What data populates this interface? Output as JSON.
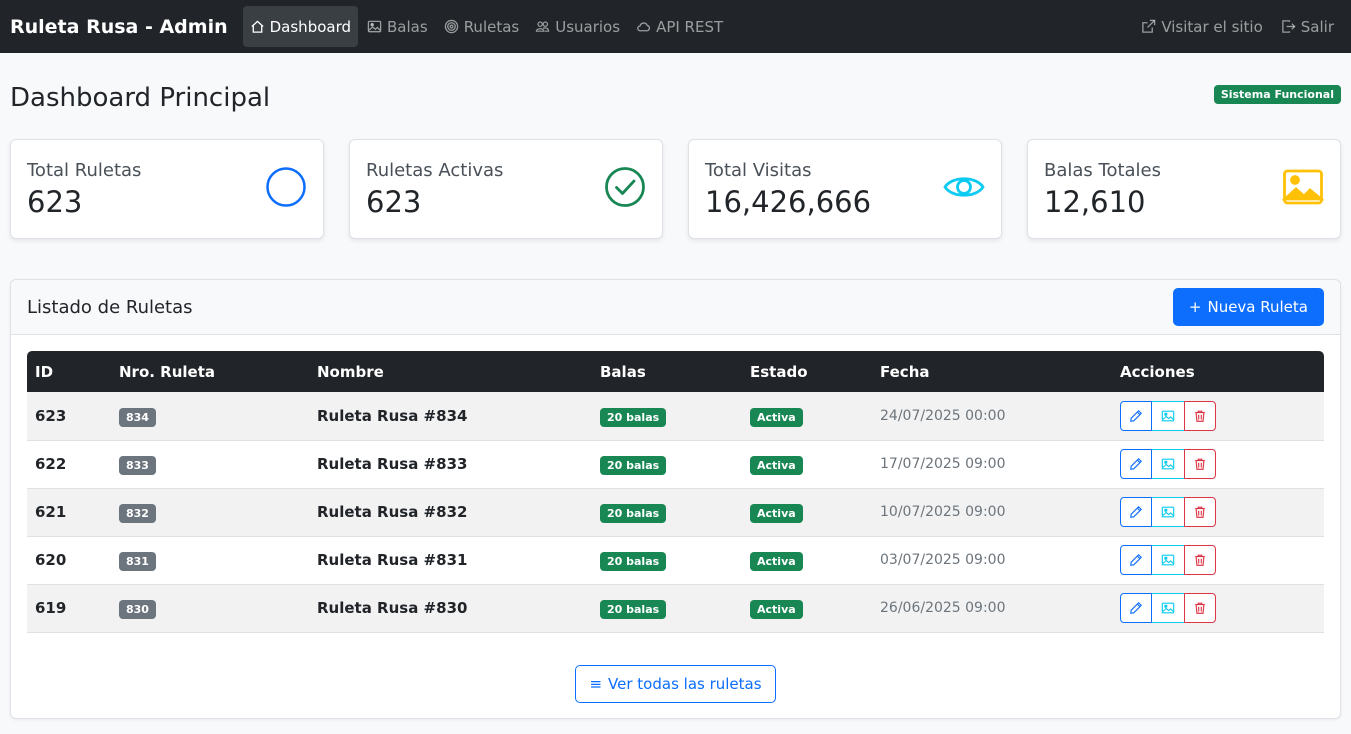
{
  "navbar": {
    "brand": "Ruleta Rusa - Admin",
    "items": [
      {
        "label": "Dashboard",
        "icon": "house-icon",
        "active": true
      },
      {
        "label": "Balas",
        "icon": "image-icon",
        "active": false
      },
      {
        "label": "Ruletas",
        "icon": "target-icon",
        "active": false
      },
      {
        "label": "Usuarios",
        "icon": "people-icon",
        "active": false
      },
      {
        "label": "API REST",
        "icon": "cloud-icon",
        "active": false
      }
    ],
    "right": [
      {
        "label": "Visitar el sitio",
        "icon": "external-link-icon"
      },
      {
        "label": "Salir",
        "icon": "logout-icon"
      }
    ]
  },
  "page": {
    "title": "Dashboard Principal",
    "status": "Sistema Funcional"
  },
  "stats": [
    {
      "label": "Total Ruletas",
      "value": "623",
      "icon": "circle-icon",
      "color": "#0d6efd"
    },
    {
      "label": "Ruletas Activas",
      "value": "623",
      "icon": "check-circle-icon",
      "color": "#198754"
    },
    {
      "label": "Total Visitas",
      "value": "16,426,666",
      "icon": "eye-icon",
      "color": "#0dcaf0"
    },
    {
      "label": "Balas Totales",
      "value": "12,610",
      "icon": "image-icon",
      "color": "#ffc107"
    }
  ],
  "list": {
    "title": "Listado de Ruletas",
    "new_button": "Nueva Ruleta",
    "columns": [
      "ID",
      "Nro. Ruleta",
      "Nombre",
      "Balas",
      "Estado",
      "Fecha",
      "Acciones"
    ],
    "rows": [
      {
        "id": "623",
        "nro": "834",
        "nombre": "Ruleta Rusa #834",
        "balas": "20 balas",
        "estado": "Activa",
        "fecha": "24/07/2025 00:00"
      },
      {
        "id": "622",
        "nro": "833",
        "nombre": "Ruleta Rusa #833",
        "balas": "20 balas",
        "estado": "Activa",
        "fecha": "17/07/2025 09:00"
      },
      {
        "id": "621",
        "nro": "832",
        "nombre": "Ruleta Rusa #832",
        "balas": "20 balas",
        "estado": "Activa",
        "fecha": "10/07/2025 09:00"
      },
      {
        "id": "620",
        "nro": "831",
        "nombre": "Ruleta Rusa #831",
        "balas": "20 balas",
        "estado": "Activa",
        "fecha": "03/07/2025 09:00"
      },
      {
        "id": "619",
        "nro": "830",
        "nombre": "Ruleta Rusa #830",
        "balas": "20 balas",
        "estado": "Activa",
        "fecha": "26/06/2025 09:00"
      }
    ],
    "view_all": "Ver todas las ruletas"
  }
}
